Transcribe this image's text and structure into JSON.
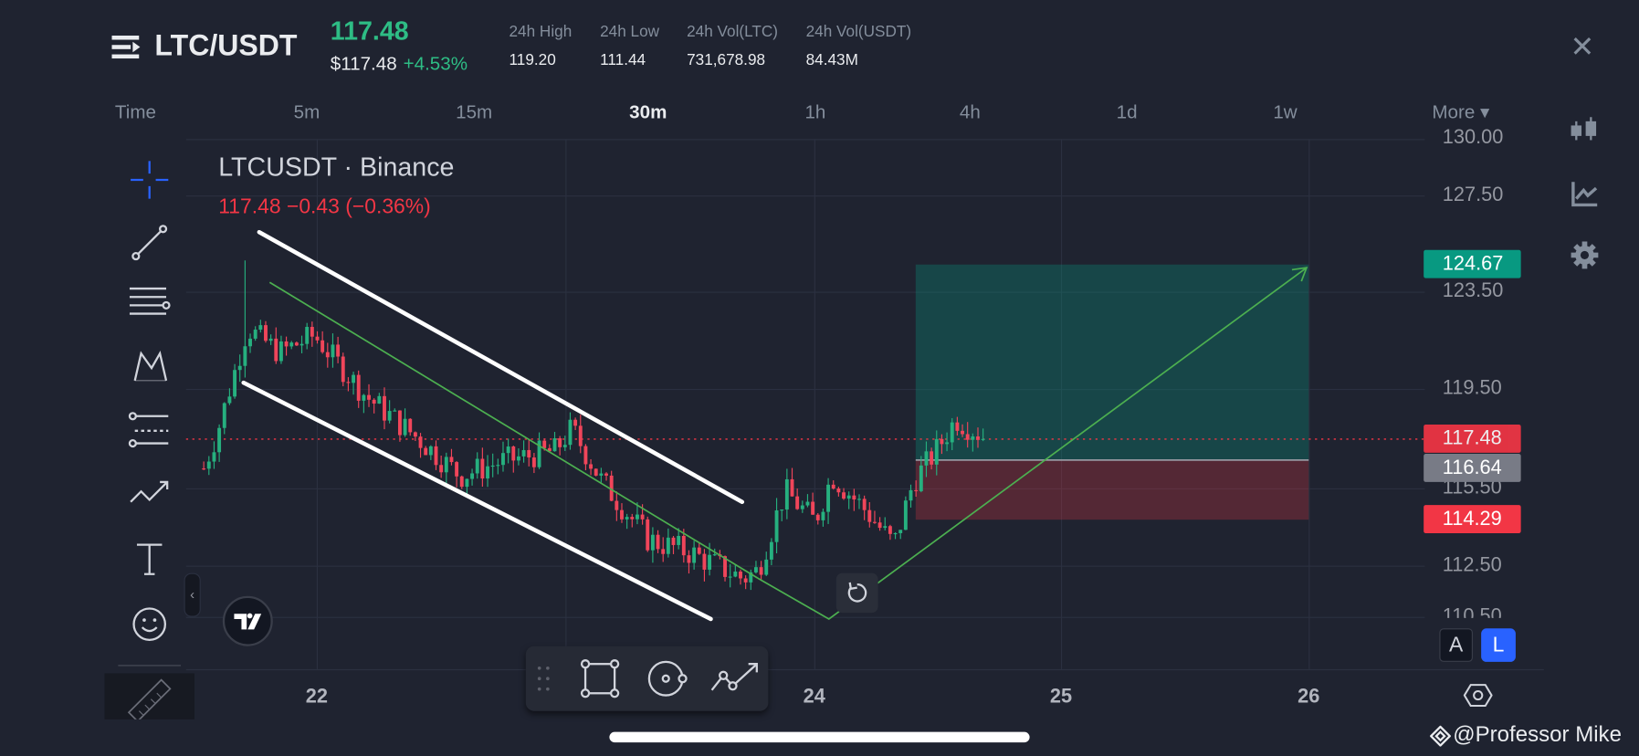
{
  "header": {
    "symbol": "LTC/USDT",
    "last_price": "117.48",
    "usd_price": "$117.48",
    "change_pct": "+4.53%",
    "stats": [
      {
        "label": "24h High",
        "value": "119.20"
      },
      {
        "label": "24h Low",
        "value": "111.44"
      },
      {
        "label": "24h Vol(LTC)",
        "value": "731,678.98"
      },
      {
        "label": "24h Vol(USDT)",
        "value": "84.43M"
      }
    ],
    "close_label": "✕"
  },
  "timeframes": {
    "time_label": "Time",
    "items": [
      "5m",
      "15m",
      "30m",
      "1h",
      "4h",
      "1d",
      "1w"
    ],
    "active": "30m",
    "more_label": "More ▾"
  },
  "chart": {
    "title": "LTCUSDT · Binance",
    "quote": "117.48  −0.43 (−0.36%)",
    "price_ticks": [
      "130.00",
      "127.50",
      "123.50",
      "119.50",
      "115.50",
      "112.50",
      "110.50"
    ],
    "date_ticks": [
      "22",
      "24",
      "25",
      "26"
    ],
    "badges": {
      "target": "124.67",
      "current": "117.48",
      "entry": "116.64",
      "stop": "114.29"
    },
    "colors": {
      "up": "#26b07f",
      "down": "#f0455a",
      "target": "#089981",
      "stop": "#f23645",
      "entry": "#787b86"
    }
  },
  "chart_data": {
    "type": "candlestick",
    "interval": "30m",
    "x_unit": "day",
    "price_path": [
      [
        21.544,
        116.3
      ],
      [
        21.6,
        117.8
      ],
      [
        21.72,
        122
      ],
      [
        21.85,
        121
      ],
      [
        21.99,
        121.7
      ],
      [
        22.2,
        119.2
      ],
      [
        22.41,
        117.5
      ],
      [
        22.58,
        116
      ],
      [
        22.75,
        116.6
      ],
      [
        22.96,
        117
      ],
      [
        23.03,
        117.9
      ],
      [
        23.15,
        115.8
      ],
      [
        23.34,
        113.5
      ],
      [
        23.51,
        113
      ],
      [
        23.72,
        112
      ],
      [
        23.78,
        112.3
      ],
      [
        23.89,
        115.4
      ],
      [
        24.01,
        114.2
      ],
      [
        24.08,
        116
      ],
      [
        24.22,
        114.6
      ],
      [
        24.33,
        113.3
      ],
      [
        24.41,
        115.8
      ],
      [
        24.5,
        117
      ],
      [
        24.58,
        118.3
      ],
      [
        24.69,
        117.6
      ]
    ],
    "spike": {
      "day": 21.72,
      "high": 124.8
    }
  },
  "buttons": {
    "a": "A",
    "l": "L"
  },
  "watermark": "@Professor Mike"
}
